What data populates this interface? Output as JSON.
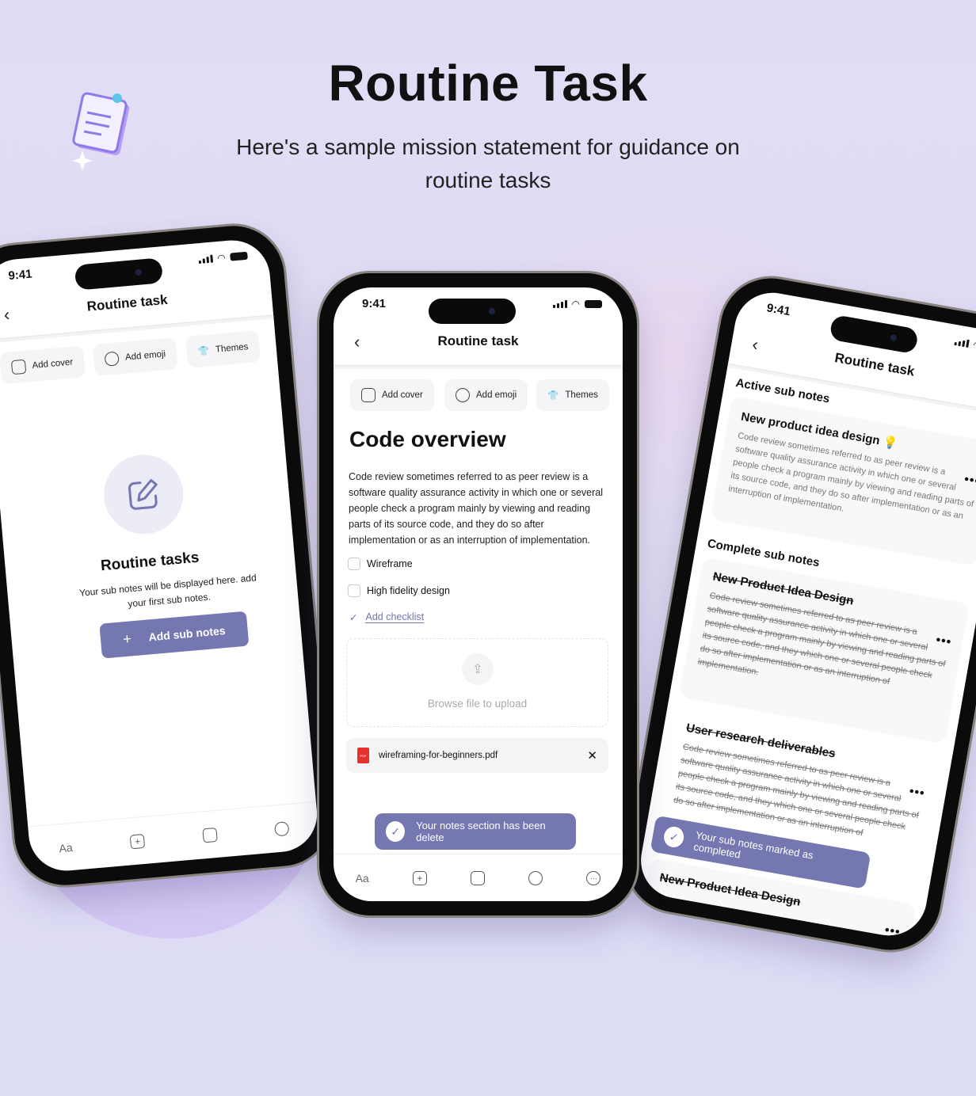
{
  "header": {
    "title": "Routine Task",
    "subtitle": "Here's a sample mission statement for guidance on routine tasks"
  },
  "colors": {
    "accent": "#7477b0",
    "background": "#dfddf6",
    "blob": "#d5c7f4"
  },
  "status_bar": {
    "time": "9:41"
  },
  "chips": {
    "cover": "Add cover",
    "emoji": "Add emoji",
    "themes": "Themes"
  },
  "nav": {
    "title": "Routine task"
  },
  "bottom_bar": {
    "text": "Aa",
    "icons": [
      "add-square-icon",
      "image-icon",
      "microphone-icon",
      "more-icon"
    ]
  },
  "left_phone": {
    "empty_title": "Routine tasks",
    "empty_text": "Your sub notes will be displayed here. add your first sub notes.",
    "button": "Add sub notes"
  },
  "center_phone": {
    "title": "Code overview",
    "body": "Code review sometimes referred to as peer review is a software quality assurance activity in which one or several people check a program mainly by viewing and reading parts of its source code, and they do so after implementation or as an interruption of implementation.",
    "checklist": [
      "Wireframe",
      "High fidelity design"
    ],
    "add_checklist": "Add checklist",
    "upload": "Browse file to upload",
    "file": "wireframing-for-beginners.pdf",
    "pdf_badge": "PDF",
    "toast": "Your notes section has been delete"
  },
  "right_phone": {
    "active_heading": "Active sub notes",
    "active": {
      "title": "New product idea design",
      "body": "Code review sometimes referred to as peer review is a software quality assurance activity in which one or several people check a program mainly by viewing and reading parts of its source code, and they do so after implementation or as an interruption of implementation."
    },
    "complete_heading": "Complete sub notes",
    "complete": [
      {
        "title": "New Product Idea Design",
        "body": "Code review sometimes referred to as peer review is a software quality assurance activity in which one or several people check a program mainly by viewing and reading parts of its source code, and they which one or several people check do so after implementation or as an interruption of implementation."
      },
      {
        "title": "User research deliverables",
        "body": "Code review sometimes referred to as peer review is a software quality assurance activity in which one or several people check a program mainly by viewing and reading parts of its source code, and they which one or several people check do so after implementation or as an interruption of"
      },
      {
        "title": "New Product Idea Design"
      }
    ],
    "toast": "Your sub notes marked as completed"
  }
}
